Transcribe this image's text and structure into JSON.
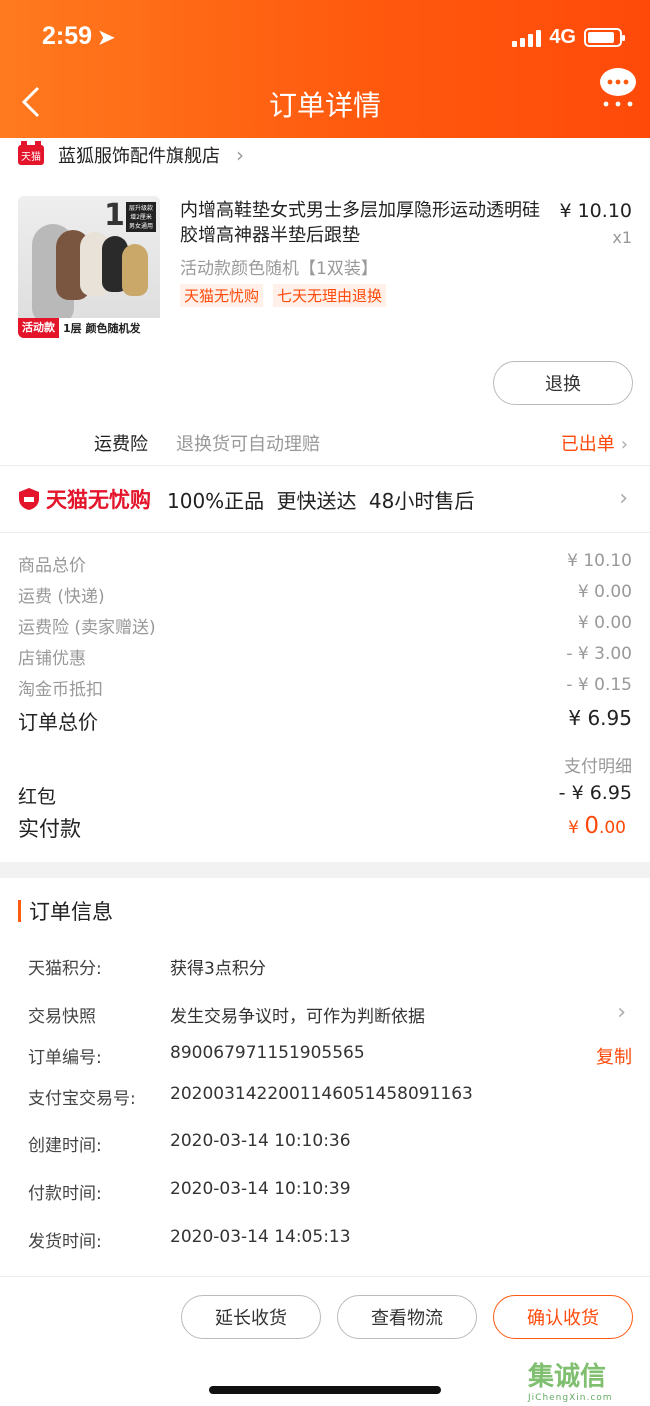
{
  "status_bar": {
    "time": "2:59",
    "network": "4G"
  },
  "header": {
    "title": "订单详情"
  },
  "store": {
    "badge": "天猫",
    "name": "蓝狐服饰配件旗舰店"
  },
  "product": {
    "title": "内增高鞋垫女式男士多层加厚隐形运动透明硅胶增高神器半垫后跟垫",
    "spec": "活动款颜色随机【1双装】",
    "tags": [
      "天猫无忧购",
      "七天无理由退换"
    ],
    "price": "¥ 10.10",
    "qty": "x1",
    "image": {
      "number": "1",
      "badge_lines": [
        "层升级款",
        "增2厘米",
        "男女通用"
      ],
      "bar_tag": "活动款",
      "bar_text": "1层 颜色随机发"
    },
    "return_button": "退换"
  },
  "freight": {
    "label": "运费险",
    "desc": "退换货可自动理赔",
    "status": "已出单"
  },
  "guarantee": {
    "brand": "天猫无忧购",
    "text": "100%正品  更快送达  48小时售后"
  },
  "prices": {
    "rows": [
      {
        "label": "商品总价",
        "value": "¥ 10.10"
      },
      {
        "label": "运费 (快递)",
        "value": "¥ 0.00"
      },
      {
        "label": "运费险 (卖家赠送)",
        "value": "¥ 0.00"
      },
      {
        "label": "店铺优惠",
        "value": "- ¥ 3.00"
      },
      {
        "label": "淘金币抵扣",
        "value": "- ¥ 0.15"
      }
    ],
    "total_label": "订单总价",
    "total_value": "¥ 6.95",
    "pay_detail": "支付明细",
    "hongbao_label": "红包",
    "hongbao_value": "- ¥ 6.95",
    "paid_label": "实付款",
    "paid_currency": "¥ ",
    "paid_int": "0",
    "paid_dec": ".00"
  },
  "order_info": {
    "heading": "订单信息",
    "points_label": "天猫积分:",
    "points_value": "获得3点积分",
    "snapshot_label": "交易快照",
    "snapshot_value": "发生交易争议时，可作为判断依据",
    "order_no_label": "订单编号:",
    "order_no_value": "890067971151905565",
    "copy_label": "复制",
    "alipay_label": "支付宝交易号:",
    "alipay_value": "2020031422001146051458091163",
    "created_label": "创建时间:",
    "created_value": "2020-03-14 10:10:36",
    "paid_label": "付款时间:",
    "paid_value": "2020-03-14 10:10:39",
    "shipped_label": "发货时间:",
    "shipped_value": "2020-03-14 14:05:13"
  },
  "actions": {
    "extend": "延长收货",
    "logistics": "查看物流",
    "confirm": "确认收货"
  },
  "watermark": {
    "chars": "集诚信",
    "sub": "JiChengXin.com"
  },
  "colors": {
    "accent": "#ff5a0e",
    "tmall_red": "#e4142b"
  }
}
